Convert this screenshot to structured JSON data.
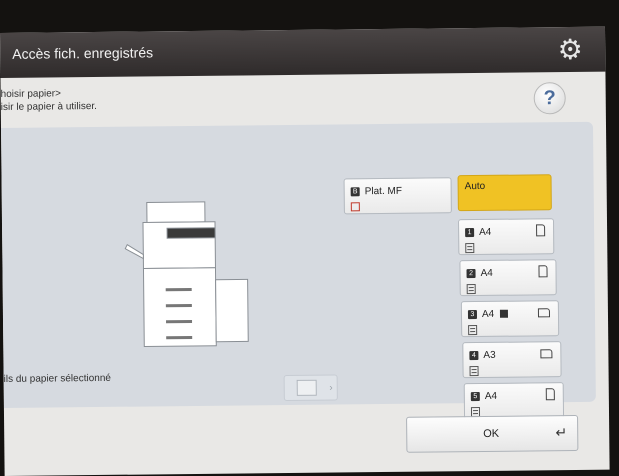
{
  "header": {
    "title": "Accès fich. enregistrés",
    "settings_icon": "gear-icon"
  },
  "instruction": {
    "line1": "hoisir papier>",
    "line2": "isir le papier à utiliser."
  },
  "help": {
    "label": "?"
  },
  "paper_info_label": "ils du papier sélectionné",
  "trays": {
    "auto": {
      "label": "Auto",
      "selected": true
    },
    "manual": {
      "num": "B",
      "label": "Plat. MF"
    },
    "t1": {
      "num": "1",
      "label": "A4"
    },
    "t2": {
      "num": "2",
      "label": "A4"
    },
    "t3": {
      "num": "3",
      "label": "A4",
      "extra_icon": "landscape-square-icon"
    },
    "t4": {
      "num": "4",
      "label": "A3"
    },
    "t5": {
      "num": "5",
      "label": "A4"
    }
  },
  "ok_button": {
    "label": "OK",
    "icon": "enter-icon"
  },
  "colors": {
    "selected": "#f0c224",
    "titlebar": "#3a3535",
    "help_text": "#4b6c9c"
  }
}
